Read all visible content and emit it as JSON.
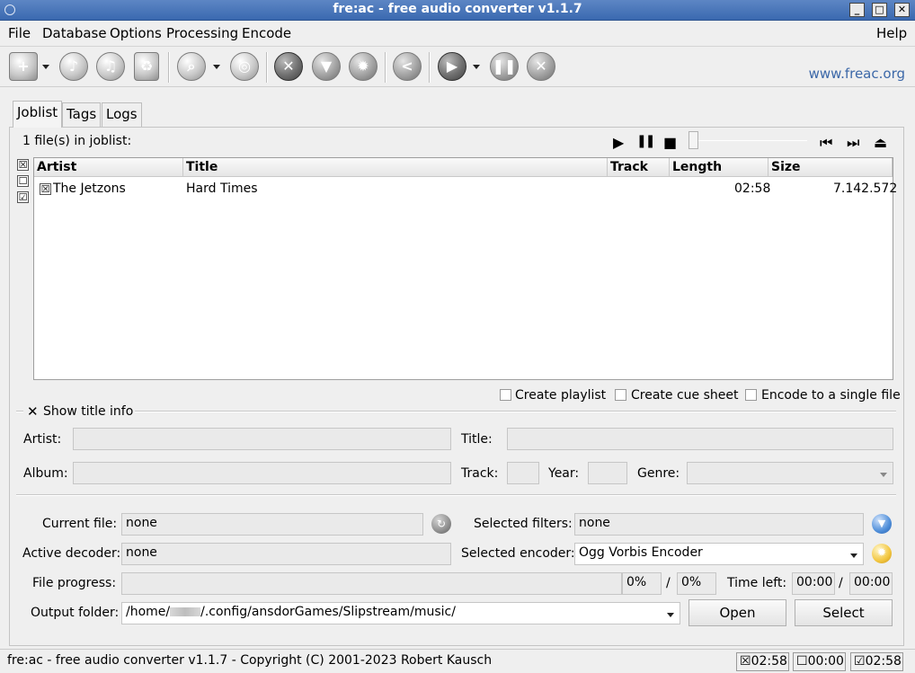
{
  "window": {
    "title": "fre:ac - free audio converter v1.1.7",
    "controls": {
      "minimize": "_",
      "maximize": "□",
      "close": "✕"
    }
  },
  "menubar": {
    "file": "File",
    "database": "Database",
    "options": "Options",
    "processing": "Processing",
    "encode": "Encode",
    "help": "Help"
  },
  "toolbar": {
    "website": "www.freac.org",
    "icons": [
      "add-files-icon",
      "add-cd-icon",
      "add-music-icon",
      "remove-icon",
      "search-icon",
      "cd-ripper-icon",
      "tools-icon",
      "filter-icon",
      "settings-icon",
      "share-icon",
      "play-icon",
      "pause-icon",
      "stop-icon"
    ]
  },
  "tabs": {
    "joblist": "Joblist",
    "tags": "Tags",
    "logs": "Logs"
  },
  "joblist": {
    "count_label": "1 file(s) in joblist:",
    "columns": {
      "artist": "Artist",
      "title": "Title",
      "track": "Track",
      "length": "Length",
      "size": "Size"
    },
    "rows": [
      {
        "checked": "☒",
        "artist": "The Jetzons",
        "title": "Hard Times",
        "track": "",
        "length": "02:58",
        "size": "7.142.572"
      }
    ],
    "select_all": "☒",
    "select_none": "☐",
    "select_toggle": "☑"
  },
  "player": {
    "play": "▶",
    "pause": "❚❚",
    "stop": "■",
    "prev": "⏮",
    "next": "⏭",
    "eject": "⏏",
    "position": 0
  },
  "options": {
    "create_playlist": "Create playlist",
    "create_cue_sheet": "Create cue sheet",
    "encode_single_file": "Encode to a single file"
  },
  "title_info": {
    "toggle_label": "Show title info",
    "toggle_mark": "✕",
    "artist_label": "Artist:",
    "title_label": "Title:",
    "album_label": "Album:",
    "track_label": "Track:",
    "year_label": "Year:",
    "genre_label": "Genre:",
    "artist_value": "",
    "title_value": "",
    "album_value": "",
    "track_value": "",
    "year_value": "",
    "genre_value": ""
  },
  "status": {
    "current_file_label": "Current file:",
    "current_file": "none",
    "selected_filters_label": "Selected filters:",
    "selected_filters": "none",
    "active_decoder_label": "Active decoder:",
    "active_decoder": "none",
    "selected_encoder_label": "Selected encoder:",
    "selected_encoder": "Ogg Vorbis Encoder",
    "file_progress_label": "File progress:",
    "file_progress_percent": "0%",
    "progress_separator": "/",
    "total_progress_percent": "0%",
    "progress_value": 0,
    "time_left_label": "Time left:",
    "time_left": "00:00",
    "time_separator": "/",
    "time_total": "00:00",
    "output_folder_label": "Output folder:",
    "output_folder_start": "/home/",
    "output_folder_end": "/.config/ansdorGames/Slipstream/music/",
    "open_button": "Open",
    "select_button": "Select"
  },
  "statusbar": {
    "copyright": "fre:ac - free audio converter v1.1.7 - Copyright (C) 2001-2023 Robert Kausch",
    "selected_mark": "☒",
    "selected_time": "02:58",
    "unselected_mark": "☐",
    "unselected_time": "00:00",
    "total_mark": "☑",
    "total_time": "02:58"
  }
}
